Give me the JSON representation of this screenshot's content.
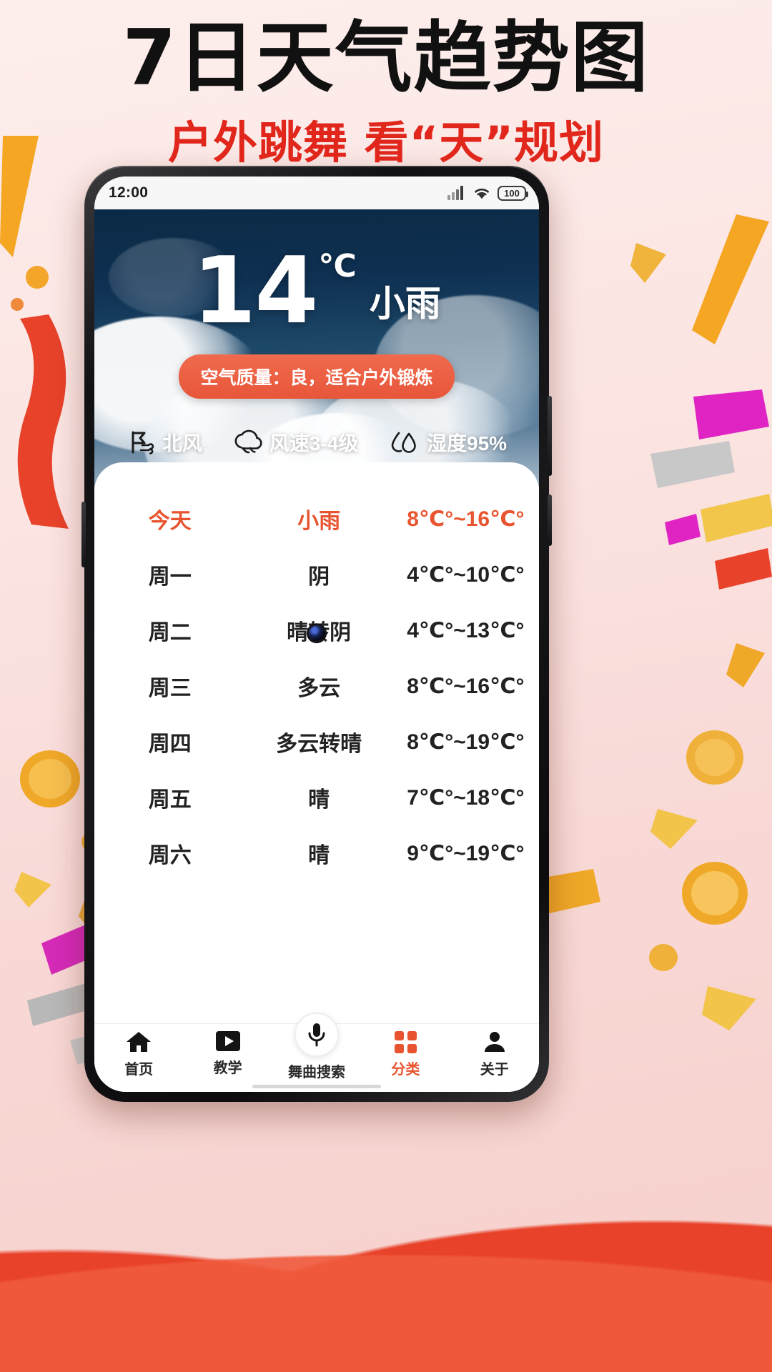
{
  "poster": {
    "title": "7日天气趋势图",
    "subtitle": "户外跳舞 看“天”规划",
    "title_color": "#111111",
    "subtitle_color": "#e1261c",
    "accent_color": "#e8542f"
  },
  "status_bar": {
    "time": "12:00",
    "signal_icon": "signal-bars-icon",
    "wifi_icon": "wifi-icon",
    "battery_icon": "battery-icon",
    "battery_level": "100"
  },
  "hero": {
    "temperature": "14",
    "unit": "℃",
    "condition": "小雨",
    "air_quality": "空气质量：良，适合户外锻炼",
    "details": [
      {
        "icon": "wind-direction-icon",
        "text": "北风"
      },
      {
        "icon": "wind-speed-cloud-icon",
        "text": "风速3-4级"
      },
      {
        "icon": "humidity-droplet-icon",
        "text": "湿度95%"
      }
    ]
  },
  "forecast": {
    "rows": [
      {
        "day": "今天",
        "condition": "小雨",
        "temp": "8℃°~16℃°",
        "today": true
      },
      {
        "day": "周一",
        "condition": "阴",
        "temp": "4℃°~10℃°",
        "today": false
      },
      {
        "day": "周二",
        "condition": "晴转阴",
        "temp": "4℃°~13℃°",
        "today": false
      },
      {
        "day": "周三",
        "condition": "多云",
        "temp": "8℃°~16℃°",
        "today": false
      },
      {
        "day": "周四",
        "condition": "多云转晴",
        "temp": "8℃°~19℃°",
        "today": false
      },
      {
        "day": "周五",
        "condition": "晴",
        "temp": "7℃°~18℃°",
        "today": false
      },
      {
        "day": "周六",
        "condition": "晴",
        "temp": "9℃°~19℃°",
        "today": false
      }
    ]
  },
  "bottom_nav": {
    "items": [
      {
        "label": "首页",
        "icon": "home-icon",
        "active": false
      },
      {
        "label": "教学",
        "icon": "play-icon",
        "active": false
      },
      {
        "label": "舞曲搜索",
        "icon": "microphone-icon",
        "active": false
      },
      {
        "label": "分类",
        "icon": "grid-icon",
        "active": true
      },
      {
        "label": "关于",
        "icon": "person-icon",
        "active": false
      }
    ]
  }
}
